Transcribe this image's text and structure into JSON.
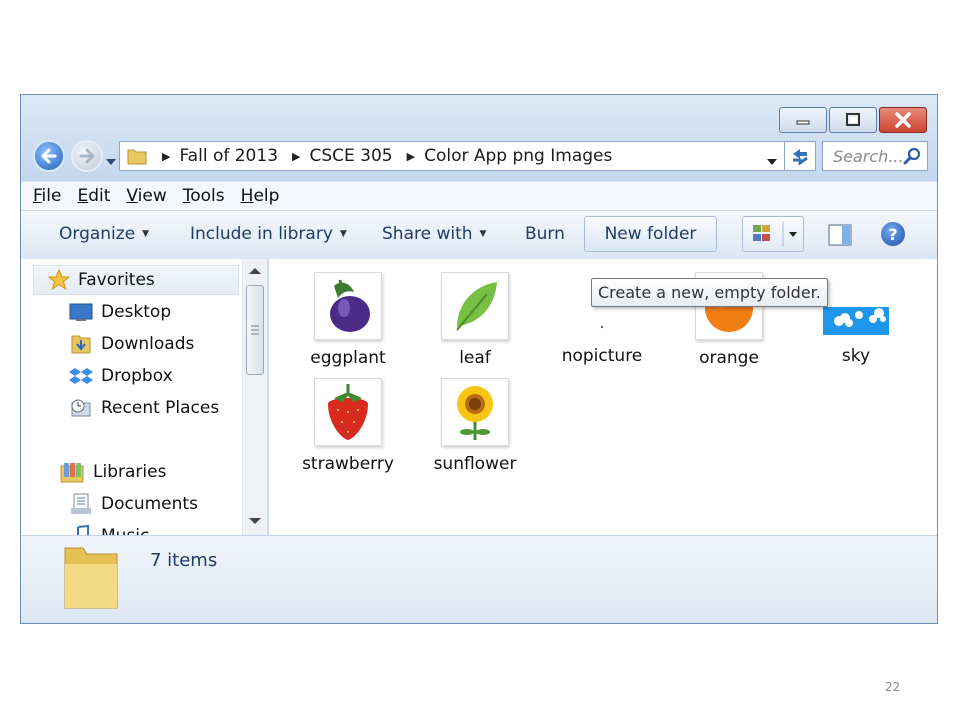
{
  "window": {
    "title_buttons": {
      "minimize": "minimize",
      "maximize": "maximize",
      "close": "close"
    }
  },
  "address": {
    "crumbs": [
      "Fall of 2013",
      "CSCE 305",
      "Color App png Images"
    ]
  },
  "search": {
    "placeholder": "Search..."
  },
  "menu": [
    "File",
    "Edit",
    "View",
    "Tools",
    "Help"
  ],
  "commands": {
    "organize": "Organize",
    "include": "Include in library",
    "share": "Share with",
    "burn": "Burn",
    "new_folder": "New folder"
  },
  "tooltip": "Create a new, empty folder.",
  "nav": {
    "favorites": "Favorites",
    "desktop": "Desktop",
    "downloads": "Downloads",
    "dropbox": "Dropbox",
    "recent": "Recent Places",
    "libraries": "Libraries",
    "documents": "Documents",
    "music": "Music"
  },
  "files": [
    {
      "name": "eggplant",
      "icon": "eggplant-icon"
    },
    {
      "name": "leaf",
      "icon": "leaf-icon"
    },
    {
      "name": "nopicture",
      "icon": "blank-icon"
    },
    {
      "name": "orange",
      "icon": "orange-icon"
    },
    {
      "name": "sky",
      "icon": "sky-icon"
    },
    {
      "name": "strawberry",
      "icon": "strawberry-icon"
    },
    {
      "name": "sunflower",
      "icon": "sunflower-icon"
    }
  ],
  "status": {
    "item_count": "7 items"
  },
  "slide_number": "22"
}
